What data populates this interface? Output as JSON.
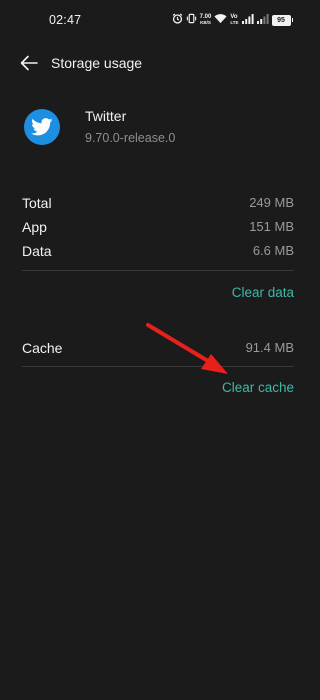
{
  "status_bar": {
    "time": "02:47",
    "net_speed_value": "7.00",
    "net_speed_unit": "KB/S",
    "volte_top": "Vo",
    "volte_bottom": "LTE",
    "battery": "95"
  },
  "header": {
    "title": "Storage usage"
  },
  "app": {
    "name": "Twitter",
    "version": "9.70.0-release.0",
    "icon": "twitter-bird-icon",
    "icon_color": "#1d8fe0"
  },
  "storage": {
    "rows": [
      {
        "label": "Total",
        "value": "249 MB"
      },
      {
        "label": "App",
        "value": "151 MB"
      },
      {
        "label": "Data",
        "value": "6.6 MB"
      }
    ],
    "clear_data_label": "Clear data"
  },
  "cache": {
    "label": "Cache",
    "value": "91.4 MB",
    "clear_cache_label": "Clear cache"
  },
  "colors": {
    "background": "#1b1b1b",
    "accent": "#3fb8a6",
    "annotation_arrow": "#e8201c"
  }
}
